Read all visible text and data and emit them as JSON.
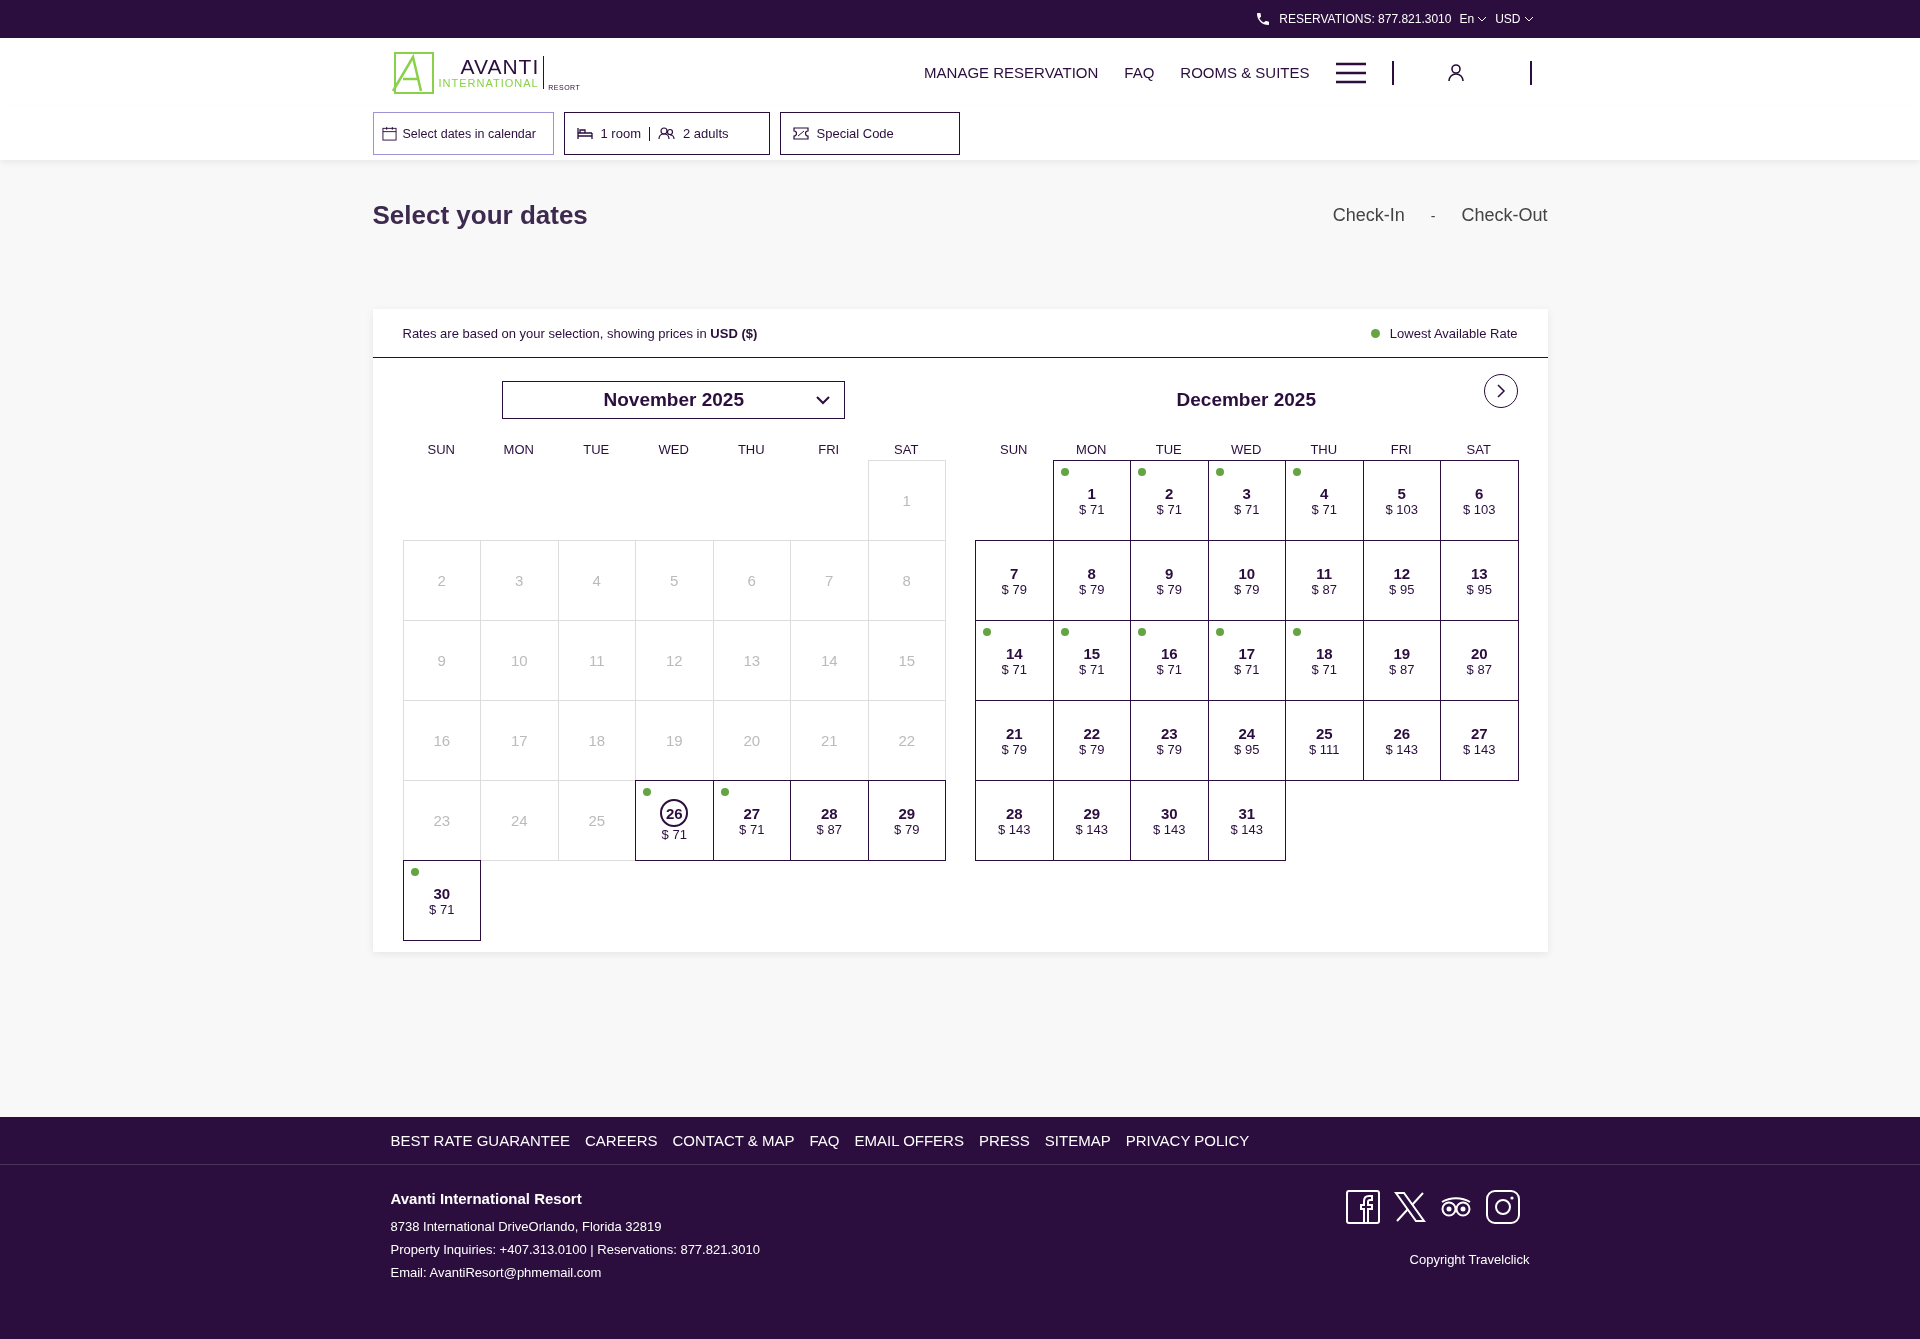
{
  "top_bar": {
    "reservations": "RESERVATIONS: 877.821.3010",
    "language": "En",
    "currency": "USD"
  },
  "header": {
    "logo": {
      "name": "AVANTI",
      "sub": "INTERNATIONAL",
      "tag": "RESORT"
    },
    "nav": [
      "MANAGE RESERVATION",
      "FAQ",
      "ROOMS & SUITES"
    ]
  },
  "search_bar": {
    "dates": "Select dates in calendar",
    "rooms": "1 room",
    "guests": "2 adults",
    "code": "Special Code"
  },
  "page": {
    "title": "Select your dates",
    "check_in": "Check-In",
    "separator": "-",
    "check_out": "Check-Out"
  },
  "calendar": {
    "note": "Rates are based on your selection, showing prices in **USD ($)**",
    "legend": {
      "label": "Lowest Available Rate",
      "color": "#66a443"
    },
    "months": [
      {
        "title": "November 2025",
        "kind": "dropdown",
        "has_next": false,
        "weekdays": [
          "SUN",
          "MON",
          "TUE",
          "WED",
          "THU",
          "FRI",
          "SAT"
        ],
        "weeks": [
          [
            {
              "kind": "blank"
            },
            {
              "kind": "blank"
            },
            {
              "kind": "blank"
            },
            {
              "kind": "blank"
            },
            {
              "kind": "blank"
            },
            {
              "kind": "blank"
            },
            {
              "day": "1",
              "available": false,
              "lowest": false,
              "circled": false
            }
          ],
          [
            {
              "day": "2",
              "available": false,
              "lowest": false,
              "circled": false
            },
            {
              "day": "3",
              "available": false,
              "lowest": false,
              "circled": false
            },
            {
              "day": "4",
              "available": false,
              "lowest": false,
              "circled": false
            },
            {
              "day": "5",
              "available": false,
              "lowest": false,
              "circled": false
            },
            {
              "day": "6",
              "available": false,
              "lowest": false,
              "circled": false
            },
            {
              "day": "7",
              "available": false,
              "lowest": false,
              "circled": false
            },
            {
              "day": "8",
              "available": false,
              "lowest": false,
              "circled": false
            }
          ],
          [
            {
              "day": "9",
              "available": false,
              "lowest": false,
              "circled": false
            },
            {
              "day": "10",
              "available": false,
              "lowest": false,
              "circled": false
            },
            {
              "day": "11",
              "available": false,
              "lowest": false,
              "circled": false
            },
            {
              "day": "12",
              "available": false,
              "lowest": false,
              "circled": false
            },
            {
              "day": "13",
              "available": false,
              "lowest": false,
              "circled": false
            },
            {
              "day": "14",
              "available": false,
              "lowest": false,
              "circled": false
            },
            {
              "day": "15",
              "available": false,
              "lowest": false,
              "circled": false
            }
          ],
          [
            {
              "day": "16",
              "available": false,
              "lowest": false,
              "circled": false
            },
            {
              "day": "17",
              "available": false,
              "lowest": false,
              "circled": false
            },
            {
              "day": "18",
              "available": false,
              "lowest": false,
              "circled": false
            },
            {
              "day": "19",
              "available": false,
              "lowest": false,
              "circled": false
            },
            {
              "day": "20",
              "available": false,
              "lowest": false,
              "circled": false
            },
            {
              "day": "21",
              "available": false,
              "lowest": false,
              "circled": false
            },
            {
              "day": "22",
              "available": false,
              "lowest": false,
              "circled": false
            }
          ],
          [
            {
              "day": "23",
              "available": false,
              "lowest": false,
              "circled": false
            },
            {
              "day": "24",
              "available": false,
              "lowest": false,
              "circled": false
            },
            {
              "day": "25",
              "available": false,
              "lowest": false,
              "circled": false
            },
            {
              "day": "26",
              "price": "$ 71",
              "available": true,
              "lowest": true,
              "circled": true
            },
            {
              "day": "27",
              "price": "$ 71",
              "available": true,
              "lowest": true,
              "circled": false
            },
            {
              "day": "28",
              "price": "$ 87",
              "available": true,
              "lowest": false,
              "circled": false
            },
            {
              "day": "29",
              "price": "$ 79",
              "available": true,
              "lowest": false,
              "circled": false
            }
          ],
          [
            {
              "day": "30",
              "price": "$ 71",
              "available": true,
              "lowest": true,
              "circled": false
            }
          ]
        ]
      },
      {
        "title": "December 2025",
        "kind": "title",
        "has_next": true,
        "weekdays": [
          "SUN",
          "MON",
          "TUE",
          "WED",
          "THU",
          "FRI",
          "SAT"
        ],
        "weeks": [
          [
            {
              "kind": "blank"
            },
            {
              "day": "1",
              "price": "$ 71",
              "available": true,
              "lowest": true,
              "circled": false
            },
            {
              "day": "2",
              "price": "$ 71",
              "available": true,
              "lowest": true,
              "circled": false
            },
            {
              "day": "3",
              "price": "$ 71",
              "available": true,
              "lowest": true,
              "circled": false
            },
            {
              "day": "4",
              "price": "$ 71",
              "available": true,
              "lowest": true,
              "circled": false
            },
            {
              "day": "5",
              "price": "$ 103",
              "available": true,
              "lowest": false,
              "circled": false
            },
            {
              "day": "6",
              "price": "$ 103",
              "available": true,
              "lowest": false,
              "circled": false
            }
          ],
          [
            {
              "day": "7",
              "price": "$ 79",
              "available": true,
              "lowest": false,
              "circled": false
            },
            {
              "day": "8",
              "price": "$ 79",
              "available": true,
              "lowest": false,
              "circled": false
            },
            {
              "day": "9",
              "price": "$ 79",
              "available": true,
              "lowest": false,
              "circled": false
            },
            {
              "day": "10",
              "price": "$ 79",
              "available": true,
              "lowest": false,
              "circled": false
            },
            {
              "day": "11",
              "price": "$ 87",
              "available": true,
              "lowest": false,
              "circled": false
            },
            {
              "day": "12",
              "price": "$ 95",
              "available": true,
              "lowest": false,
              "circled": false
            },
            {
              "day": "13",
              "price": "$ 95",
              "available": true,
              "lowest": false,
              "circled": false
            }
          ],
          [
            {
              "day": "14",
              "price": "$ 71",
              "available": true,
              "lowest": true,
              "circled": false
            },
            {
              "day": "15",
              "price": "$ 71",
              "available": true,
              "lowest": true,
              "circled": false
            },
            {
              "day": "16",
              "price": "$ 71",
              "available": true,
              "lowest": true,
              "circled": false
            },
            {
              "day": "17",
              "price": "$ 71",
              "available": true,
              "lowest": true,
              "circled": false
            },
            {
              "day": "18",
              "price": "$ 71",
              "available": true,
              "lowest": true,
              "circled": false
            },
            {
              "day": "19",
              "price": "$ 87",
              "available": true,
              "lowest": false,
              "circled": false
            },
            {
              "day": "20",
              "price": "$ 87",
              "available": true,
              "lowest": false,
              "circled": false
            }
          ],
          [
            {
              "day": "21",
              "price": "$ 79",
              "available": true,
              "lowest": false,
              "circled": false
            },
            {
              "day": "22",
              "price": "$ 79",
              "available": true,
              "lowest": false,
              "circled": false
            },
            {
              "day": "23",
              "price": "$ 79",
              "available": true,
              "lowest": false,
              "circled": false
            },
            {
              "day": "24",
              "price": "$ 95",
              "available": true,
              "lowest": false,
              "circled": false
            },
            {
              "day": "25",
              "price": "$ 111",
              "available": true,
              "lowest": false,
              "circled": false
            },
            {
              "day": "26",
              "price": "$ 143",
              "available": true,
              "lowest": false,
              "circled": false
            },
            {
              "day": "27",
              "price": "$ 143",
              "available": true,
              "lowest": false,
              "circled": false
            }
          ],
          [
            {
              "day": "28",
              "price": "$ 143",
              "available": true,
              "lowest": false,
              "circled": false
            },
            {
              "day": "29",
              "price": "$ 143",
              "available": true,
              "lowest": false,
              "circled": false
            },
            {
              "day": "30",
              "price": "$ 143",
              "available": true,
              "lowest": false,
              "circled": false
            },
            {
              "day": "31",
              "price": "$ 143",
              "available": true,
              "lowest": false,
              "circled": false
            }
          ]
        ]
      }
    ]
  },
  "footer": {
    "links": [
      "BEST RATE GUARANTEE",
      "CAREERS",
      "CONTACT & MAP",
      "FAQ",
      "EMAIL OFFERS",
      "PRESS",
      "SITEMAP",
      "PRIVACY POLICY"
    ],
    "name": "Avanti International Resort",
    "lines": [
      "8738 International DriveOrlando, Florida 32819",
      "Property Inquiries: +407.313.0100 | Reservations: 877.821.3010",
      "Email: AvantiResort@phmemail.com"
    ],
    "copyright": "Copyright Travelclick"
  }
}
